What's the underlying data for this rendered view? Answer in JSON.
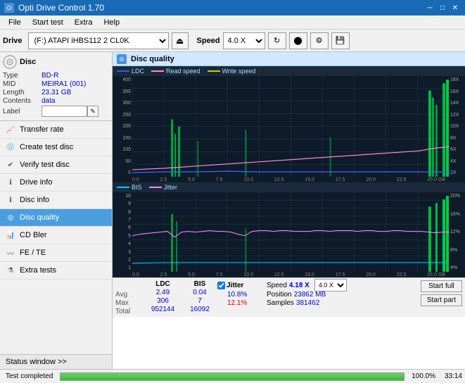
{
  "titlebar": {
    "title": "Opti Drive Control 1.70",
    "icon": "O",
    "minimize": "─",
    "maximize": "□",
    "close": "✕"
  },
  "menubar": {
    "items": [
      "File",
      "Start test",
      "Extra",
      "Help"
    ]
  },
  "toolbar": {
    "drive_label": "Drive",
    "drive_value": "(F:)  ATAPI iHBS112  2 CL0K",
    "speed_label": "Speed",
    "speed_value": "4.0 X"
  },
  "sidebar": {
    "disc_section": {
      "type_label": "Type",
      "type_value": "BD-R",
      "mid_label": "MID",
      "mid_value": "MEIRA1 (001)",
      "length_label": "Length",
      "length_value": "23.31 GB",
      "contents_label": "Contents",
      "contents_value": "data",
      "label_label": "Label"
    },
    "nav_items": [
      {
        "id": "transfer-rate",
        "label": "Transfer rate"
      },
      {
        "id": "create-test-disc",
        "label": "Create test disc"
      },
      {
        "id": "verify-test-disc",
        "label": "Verify test disc"
      },
      {
        "id": "drive-info",
        "label": "Drive info"
      },
      {
        "id": "disc-info",
        "label": "Disc info"
      },
      {
        "id": "disc-quality",
        "label": "Disc quality",
        "active": true
      },
      {
        "id": "cd-bler",
        "label": "CD Bler"
      },
      {
        "id": "fe-te",
        "label": "FE / TE"
      },
      {
        "id": "extra-tests",
        "label": "Extra tests"
      }
    ],
    "status_window": "Status window >>"
  },
  "disc_quality": {
    "title": "Disc quality",
    "legend": [
      {
        "id": "ldc",
        "label": "LDC",
        "color": "#0000ff"
      },
      {
        "id": "read-speed",
        "label": "Read speed",
        "color": "#ff69b4"
      },
      {
        "id": "write-speed",
        "label": "Write speed",
        "color": "#cccc00"
      }
    ],
    "legend2": [
      {
        "id": "bis",
        "label": "BIS",
        "color": "#00ccff"
      },
      {
        "id": "jitter",
        "label": "Jitter",
        "color": "#ff00ff"
      }
    ],
    "top_chart": {
      "y_left": [
        "400",
        "350",
        "300",
        "250",
        "200",
        "150",
        "100",
        "50",
        "0"
      ],
      "y_right": [
        "18X",
        "16X",
        "14X",
        "12X",
        "10X",
        "8X",
        "6X",
        "4X",
        "2X"
      ],
      "x_labels": [
        "0.0",
        "2.5",
        "5.0",
        "7.5",
        "10.0",
        "12.5",
        "15.0",
        "17.5",
        "20.0",
        "22.5",
        "25.0 GB"
      ]
    },
    "bottom_chart": {
      "y_left": [
        "10",
        "9",
        "8",
        "7",
        "6",
        "5",
        "4",
        "3",
        "2",
        "1"
      ],
      "y_right": [
        "20%",
        "16%",
        "12%",
        "8%",
        "4%"
      ],
      "x_labels": [
        "0.0",
        "2.5",
        "5.0",
        "7.5",
        "10.0",
        "12.5",
        "15.0",
        "17.5",
        "20.0",
        "22.5",
        "25.0 GB"
      ]
    },
    "stats": {
      "ldc_header": "LDC",
      "bis_header": "BIS",
      "jitter_header": "Jitter",
      "avg_label": "Avg",
      "max_label": "Max",
      "total_label": "Total",
      "ldc_avg": "2.49",
      "ldc_max": "306",
      "ldc_total": "952144",
      "bis_avg": "0.04",
      "bis_max": "7",
      "bis_total": "16092",
      "jitter_avg": "10.8%",
      "jitter_max": "12.1%",
      "speed_label": "Speed",
      "speed_value": "4.18 X",
      "speed_select": "4.0 X",
      "position_label": "Position",
      "position_value": "23862 MB",
      "samples_label": "Samples",
      "samples_value": "381462",
      "btn_full": "Start full",
      "btn_part": "Start part"
    }
  },
  "progress": {
    "status_text": "Test completed",
    "percent": "100.0%",
    "time": "33:14"
  }
}
